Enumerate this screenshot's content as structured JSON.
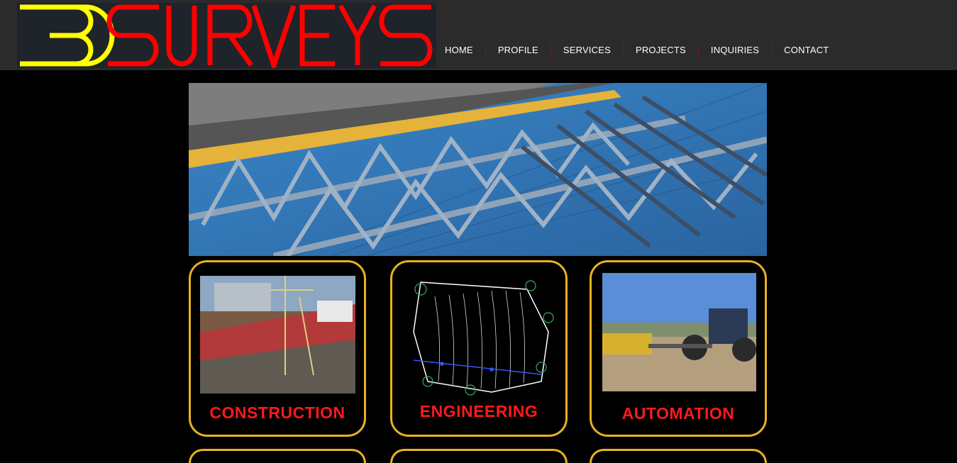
{
  "brand": {
    "logo_text_3d": "3D",
    "logo_text_surveys": "SURVEYS",
    "color_3d": "#ffff00",
    "color_surveys": "#ff0000"
  },
  "nav": {
    "items": [
      "HOME",
      "PROFILE",
      "SERVICES",
      "PROJECTS",
      "INQUIRIES",
      "CONTACT"
    ]
  },
  "hero": {
    "icon": "steel-roof-construction-photo"
  },
  "services": [
    {
      "label": "CONSTRUCTION",
      "icon": "stadium-construction-photo"
    },
    {
      "label": "ENGINEERING",
      "icon": "survey-contour-drawing"
    },
    {
      "label": "AUTOMATION",
      "icon": "tractor-grader-photo"
    }
  ],
  "colors": {
    "card_border": "#e8b220",
    "label": "#ff1a1a",
    "header_bg": "#2b2b2b"
  }
}
